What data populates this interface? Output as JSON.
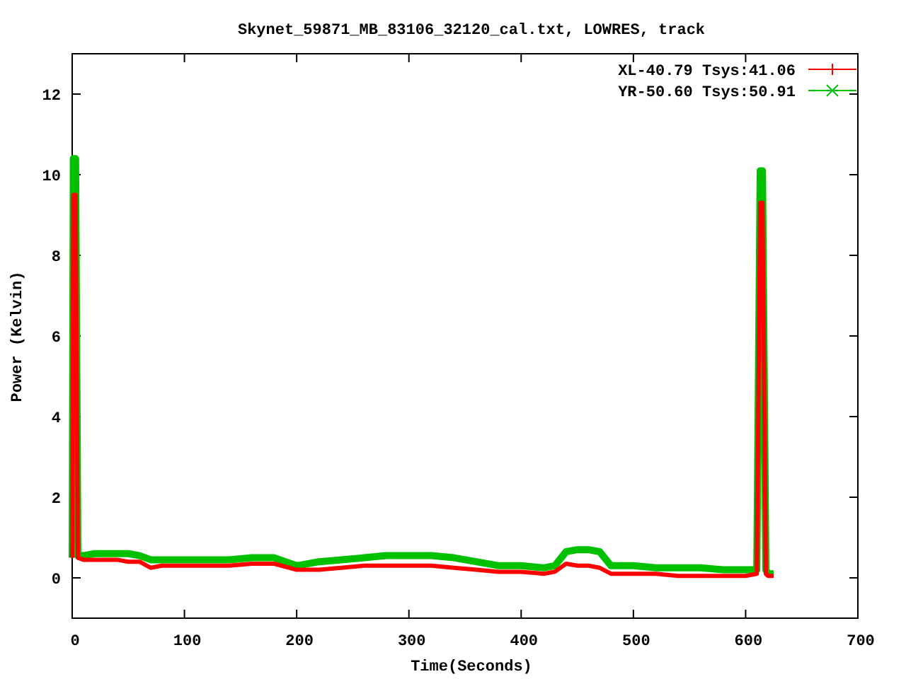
{
  "chart_data": {
    "type": "line",
    "title": "Skynet_59871_MB_83106_32120_cal.txt, LOWRES, track",
    "xlabel": "Time(Seconds)",
    "ylabel": "Power (Kelvin)",
    "x": [
      0,
      1,
      3,
      5,
      10,
      20,
      30,
      40,
      50,
      60,
      70,
      80,
      90,
      100,
      120,
      140,
      160,
      180,
      200,
      220,
      240,
      260,
      280,
      300,
      320,
      340,
      360,
      380,
      400,
      420,
      430,
      440,
      450,
      460,
      470,
      480,
      500,
      520,
      540,
      560,
      580,
      600,
      610,
      613,
      615,
      618,
      620,
      625
    ],
    "series": [
      {
        "name": "XL-40.79 Tsys:41.06",
        "color": "#ff0000",
        "values": [
          0.5,
          9.5,
          9.5,
          0.5,
          0.45,
          0.45,
          0.45,
          0.45,
          0.4,
          0.4,
          0.25,
          0.3,
          0.3,
          0.3,
          0.3,
          0.3,
          0.35,
          0.35,
          0.2,
          0.2,
          0.25,
          0.3,
          0.3,
          0.3,
          0.3,
          0.25,
          0.2,
          0.15,
          0.15,
          0.1,
          0.15,
          0.35,
          0.3,
          0.3,
          0.25,
          0.1,
          0.1,
          0.1,
          0.05,
          0.05,
          0.05,
          0.05,
          0.1,
          9.3,
          9.3,
          0.1,
          0.05,
          0.05
        ]
      },
      {
        "name": "YR-50.60 Tsys:50.91",
        "color": "#00c000",
        "values": [
          0.5,
          10.4,
          10.4,
          0.55,
          0.55,
          0.6,
          0.6,
          0.6,
          0.6,
          0.55,
          0.45,
          0.45,
          0.45,
          0.45,
          0.45,
          0.45,
          0.5,
          0.5,
          0.3,
          0.4,
          0.45,
          0.5,
          0.55,
          0.55,
          0.55,
          0.5,
          0.4,
          0.3,
          0.3,
          0.25,
          0.3,
          0.65,
          0.7,
          0.7,
          0.65,
          0.3,
          0.3,
          0.25,
          0.25,
          0.25,
          0.2,
          0.2,
          0.2,
          10.1,
          10.1,
          0.2,
          0.1,
          0.1
        ]
      }
    ],
    "legend": true,
    "xlim": [
      0,
      700
    ],
    "ylim": [
      -1,
      13
    ],
    "xticks": [
      0,
      100,
      200,
      300,
      400,
      500,
      600,
      700
    ],
    "yticks": [
      0,
      2,
      4,
      6,
      8,
      10,
      12
    ]
  }
}
